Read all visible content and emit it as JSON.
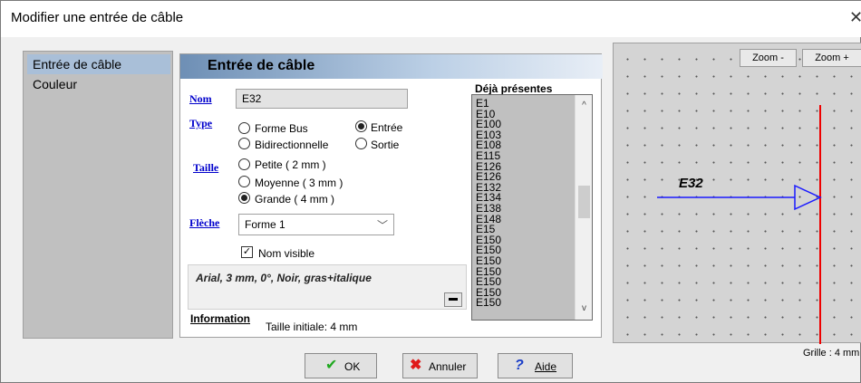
{
  "window": {
    "title": "Modifier une entrée de câble",
    "close_glyph": "✕"
  },
  "sidebar": {
    "items": [
      {
        "label": "Entrée de câble"
      },
      {
        "label": "Couleur"
      }
    ]
  },
  "panel": {
    "title": "Entrée de câble",
    "labels": {
      "nom": "Nom",
      "type": "Type",
      "taille": "Taille",
      "fleche": "Flèche",
      "information": "Information"
    },
    "nom_value": "E32",
    "type_options": {
      "forme_bus": "Forme Bus",
      "bidirectionnelle": "Bidirectionnelle",
      "entree": "Entrée",
      "sortie": "Sortie"
    },
    "taille_options": {
      "petite": "Petite ( 2 mm )",
      "moyenne": "Moyenne ( 3 mm )",
      "grande": "Grande ( 4 mm )"
    },
    "fleche_value": "Forme 1",
    "nom_visible_label": "Nom visible",
    "font_description": "Arial, 3 mm, 0°, Noir, gras+italique",
    "font_button_glyph": "▬",
    "information_text": "Taille initiale: 4 mm"
  },
  "existing": {
    "label": "Déjà présentes",
    "items": [
      "E1",
      "E10",
      "E100",
      "E103",
      "E108",
      "E115",
      "E126",
      "E126",
      "E132",
      "E134",
      "E138",
      "E148",
      "E15",
      "E150",
      "E150",
      "E150",
      "E150",
      "E150",
      "E150",
      "E150"
    ]
  },
  "preview": {
    "zoom_minus": "Zoom -",
    "zoom_plus": "Zoom +",
    "connector_label": "E32",
    "grid_label": "Grille : 4 mm",
    "colors": {
      "wire": "#1a1aff",
      "rail": "#ee0000"
    }
  },
  "buttons": {
    "ok": "OK",
    "cancel": "Annuler",
    "help": "Aide"
  },
  "icons": {
    "ok": "check-icon",
    "cancel": "cross-icon",
    "help": "question-icon"
  }
}
